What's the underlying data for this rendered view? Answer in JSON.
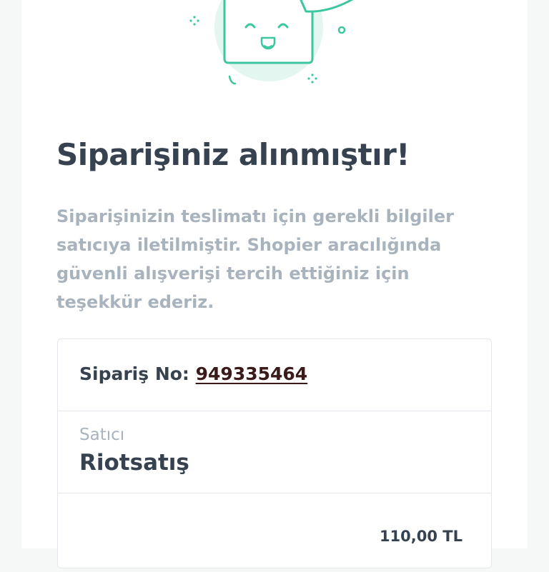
{
  "heading": "Siparişiniz alınmıştır!",
  "message": "Siparişinizin teslimatı için gerekli bilgiler satıcıya iletilmiştir. Shopier aracılığında güvenli alışverişi tercih ettiğiniz için teşekkür ederiz.",
  "order": {
    "label": "Sipariş No:",
    "number": "949335464"
  },
  "seller": {
    "label": "Satıcı",
    "name": "Riotsatış"
  },
  "total": {
    "amount": "110,00 TL"
  },
  "illustration": {
    "icon": "smiling-box-icon",
    "accent": "#3cc7a0",
    "blob": "#e3f6ef"
  }
}
